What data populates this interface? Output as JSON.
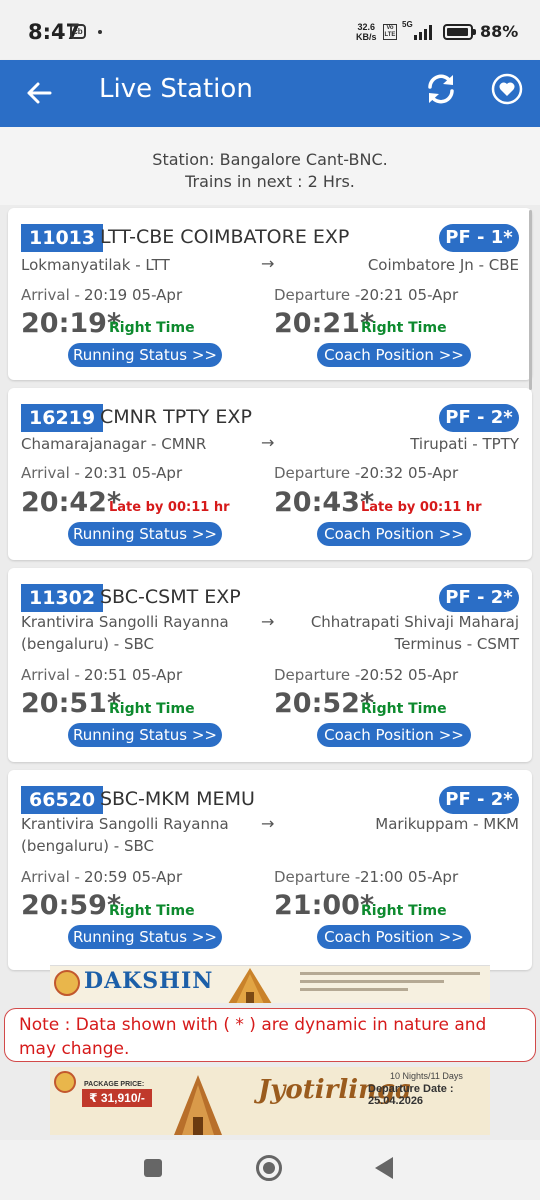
{
  "status_bar": {
    "time": "8:47",
    "cb_icon": "cb",
    "net_speed": "32.6",
    "net_speed_unit": "KB/s",
    "volte": "Vo LTE",
    "network": "5G",
    "battery_pct": "88%"
  },
  "app_bar": {
    "title": "Live Station",
    "back_icon": "arrow-left-icon",
    "refresh_icon": "refresh-icon",
    "favorite_icon": "heart-icon"
  },
  "station": {
    "line1": "Station: Bangalore Cant-BNC.",
    "line2": "Trains in next : 2 Hrs."
  },
  "trains": [
    {
      "number": "11013",
      "name": "LTT-CBE COIMBATORE EXP",
      "platform": "PF - 1*",
      "from": "Lokmanyatilak - LTT",
      "to": "Coimbatore Jn - CBE",
      "arrow": "→",
      "arrival_label": "Arrival -",
      "arrival_sched": "20:19 05-Apr",
      "departure_label": "Departure -",
      "departure_sched": "20:21 05-Apr",
      "arrival_actual": "20:19*",
      "arrival_status": "Right Time",
      "departure_actual": "20:21*",
      "departure_status": "Right Time",
      "running_btn": "Running Status >>",
      "coach_btn": "Coach Position >>"
    },
    {
      "number": "16219",
      "name": "CMNR TPTY EXP",
      "platform": "PF - 2*",
      "from": "Chamarajanagar - CMNR",
      "to": "Tirupati - TPTY",
      "arrow": "→",
      "arrival_label": "Arrival -",
      "arrival_sched": "20:31 05-Apr",
      "departure_label": "Departure -",
      "departure_sched": "20:32 05-Apr",
      "arrival_actual": "20:42*",
      "arrival_status": "Late by 00:11 hr",
      "departure_actual": "20:43*",
      "departure_status": "Late by 00:11 hr",
      "running_btn": "Running Status >>",
      "coach_btn": "Coach Position >>"
    },
    {
      "number": "11302",
      "name": "SBC-CSMT EXP",
      "platform": "PF - 2*",
      "from_line1": "Krantivira Sangolli Rayanna",
      "from_line2": "(bengaluru) - SBC",
      "to_line1": "Chhatrapati Shivaji Maharaj",
      "to_line2": "Terminus - CSMT",
      "arrow": "→",
      "arrival_label": "Arrival -",
      "arrival_sched": "20:51 05-Apr",
      "departure_label": "Departure -",
      "departure_sched": "20:52 05-Apr",
      "arrival_actual": "20:51*",
      "arrival_status": "Right Time",
      "departure_actual": "20:52*",
      "departure_status": "Right Time",
      "running_btn": "Running Status >>",
      "coach_btn": "Coach Position >>"
    },
    {
      "number": "66520",
      "name": "SBC-MKM MEMU",
      "platform": "PF - 2*",
      "from_line1": "Krantivira Sangolli Rayanna",
      "from_line2": "(bengaluru) - SBC",
      "to": "Marikuppam - MKM",
      "arrow": "→",
      "arrival_label": "Arrival -",
      "arrival_sched": "20:59 05-Apr",
      "departure_label": "Departure -",
      "departure_sched": "21:00 05-Apr",
      "arrival_actual": "20:59*",
      "arrival_status": "Right Time",
      "departure_actual": "21:00*",
      "departure_status": "Right Time",
      "running_btn": "Running Status >>",
      "coach_btn": "Coach Position >>"
    }
  ],
  "ad_top": {
    "title": "DAKSHIN"
  },
  "note": "Note : Data shown with ( * ) are dynamic in nature and may change.",
  "ad_bottom": {
    "price_label": "PACKAGE PRICE:",
    "price": "₹ 31,910/-",
    "title": "Jyotirlinga",
    "nights": "10 Nights/11 Days",
    "departure": "Departure Date : 25.04.2026"
  },
  "colors": {
    "primary": "#2b6ec6",
    "right_time": "#0d8a2e",
    "late": "#d61a1a"
  }
}
